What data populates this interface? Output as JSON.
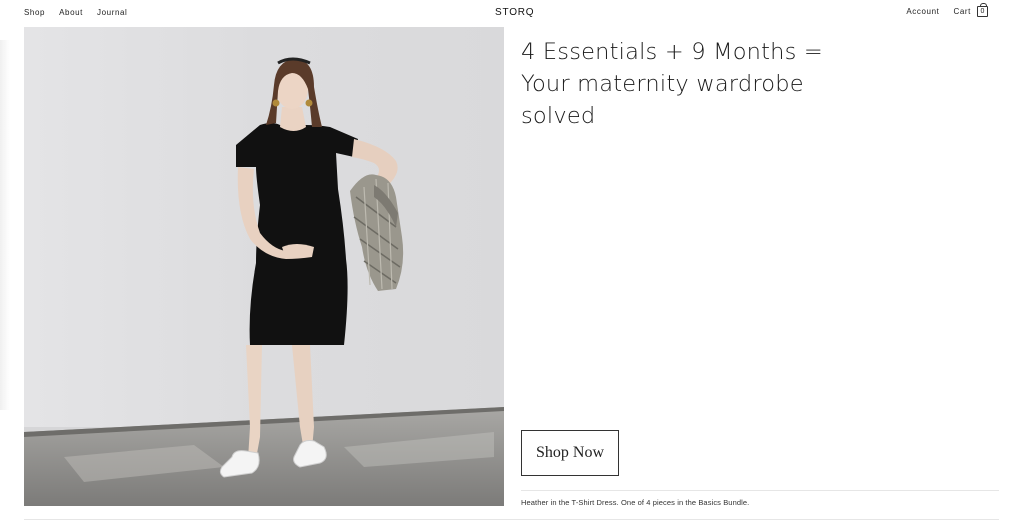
{
  "nav": {
    "left": [
      "Shop",
      "About",
      "Journal"
    ],
    "brand": "STORQ",
    "account": "Account",
    "cart": "Cart",
    "cart_count": "0"
  },
  "hero": {
    "headline_lines": [
      "4 Essentials + 9 Months =",
      "Your maternity wardrobe",
      "solved"
    ],
    "cta": "Shop Now",
    "caption": "Heather in the T-Shirt Dress. One of 4 pieces in the Basics Bundle."
  },
  "colors": {
    "text": "#1a1a1a",
    "background": "#ffffff",
    "photo_wall": "#dedee0",
    "photo_floor": "#8a8a88",
    "dress": "#111111"
  },
  "icons": [
    "bag-icon"
  ]
}
